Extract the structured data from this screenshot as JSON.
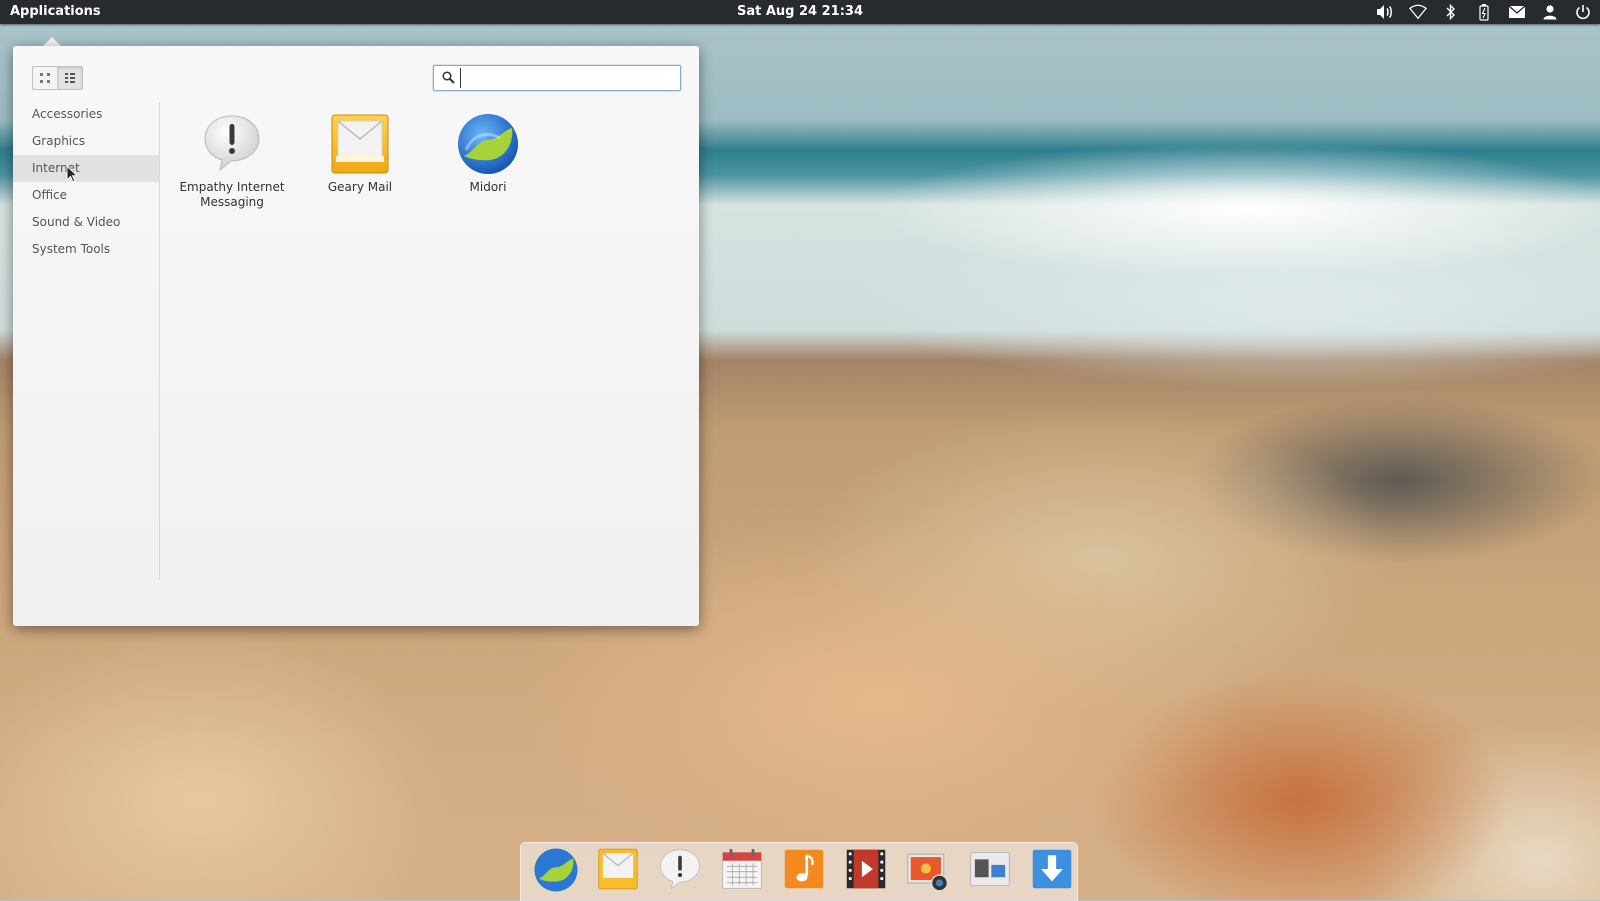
{
  "panel": {
    "applications_label": "Applications",
    "clock": "Sat Aug 24 21:34",
    "indicators": [
      "volume-icon",
      "wifi-icon",
      "bluetooth-icon",
      "battery-icon",
      "mail-icon",
      "user-icon",
      "power-icon"
    ]
  },
  "menu": {
    "view_modes": [
      "grid-view-icon",
      "category-view-icon"
    ],
    "active_view": "category-view-icon",
    "search": {
      "value": "",
      "placeholder": ""
    },
    "categories": [
      {
        "label": "Accessories"
      },
      {
        "label": "Graphics"
      },
      {
        "label": "Internet"
      },
      {
        "label": "Office"
      },
      {
        "label": "Sound & Video"
      },
      {
        "label": "System Tools"
      }
    ],
    "selected_category": "Internet",
    "apps": [
      {
        "line1": "Empathy Internet",
        "line2": "Messaging",
        "icon": "empathy-icon"
      },
      {
        "line1": "Geary Mail",
        "line2": "",
        "icon": "geary-mail-icon"
      },
      {
        "line1": "Midori",
        "line2": "",
        "icon": "midori-icon"
      }
    ]
  },
  "dock": {
    "items": [
      "midori-icon",
      "geary-mail-icon",
      "empathy-icon",
      "calendar-icon",
      "music-icon",
      "video-icon",
      "photos-icon",
      "switchboard-icon",
      "software-center-icon"
    ]
  },
  "colors": {
    "panel_bg": "#272b2f",
    "menu_bg": "#f7f7f7",
    "selected_category_bg": "#e1e1e1",
    "search_border": "#8aaad0"
  }
}
